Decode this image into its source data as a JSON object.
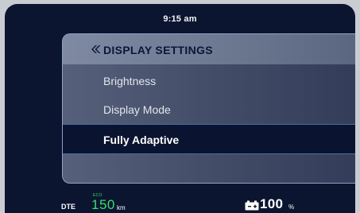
{
  "status": {
    "time": "9:15 am"
  },
  "menu": {
    "title": "DISPLAY SETTINGS",
    "back_icon": "double-chevron-left-icon",
    "items": [
      {
        "label": "Brightness",
        "selected": false
      },
      {
        "label": "Display Mode",
        "selected": false
      },
      {
        "label": "Fully Adaptive",
        "selected": true
      }
    ]
  },
  "footer": {
    "dte_label": "DTE",
    "mode_label": "ECO",
    "range_value": "150",
    "range_unit": "km",
    "battery_value": "100",
    "battery_unit": "%",
    "battery_icon": "battery-icon"
  },
  "colors": {
    "background": "#0b1530",
    "range_green": "#33e06a",
    "header_text": "#0a1738",
    "selected_row": "#0a1430"
  }
}
